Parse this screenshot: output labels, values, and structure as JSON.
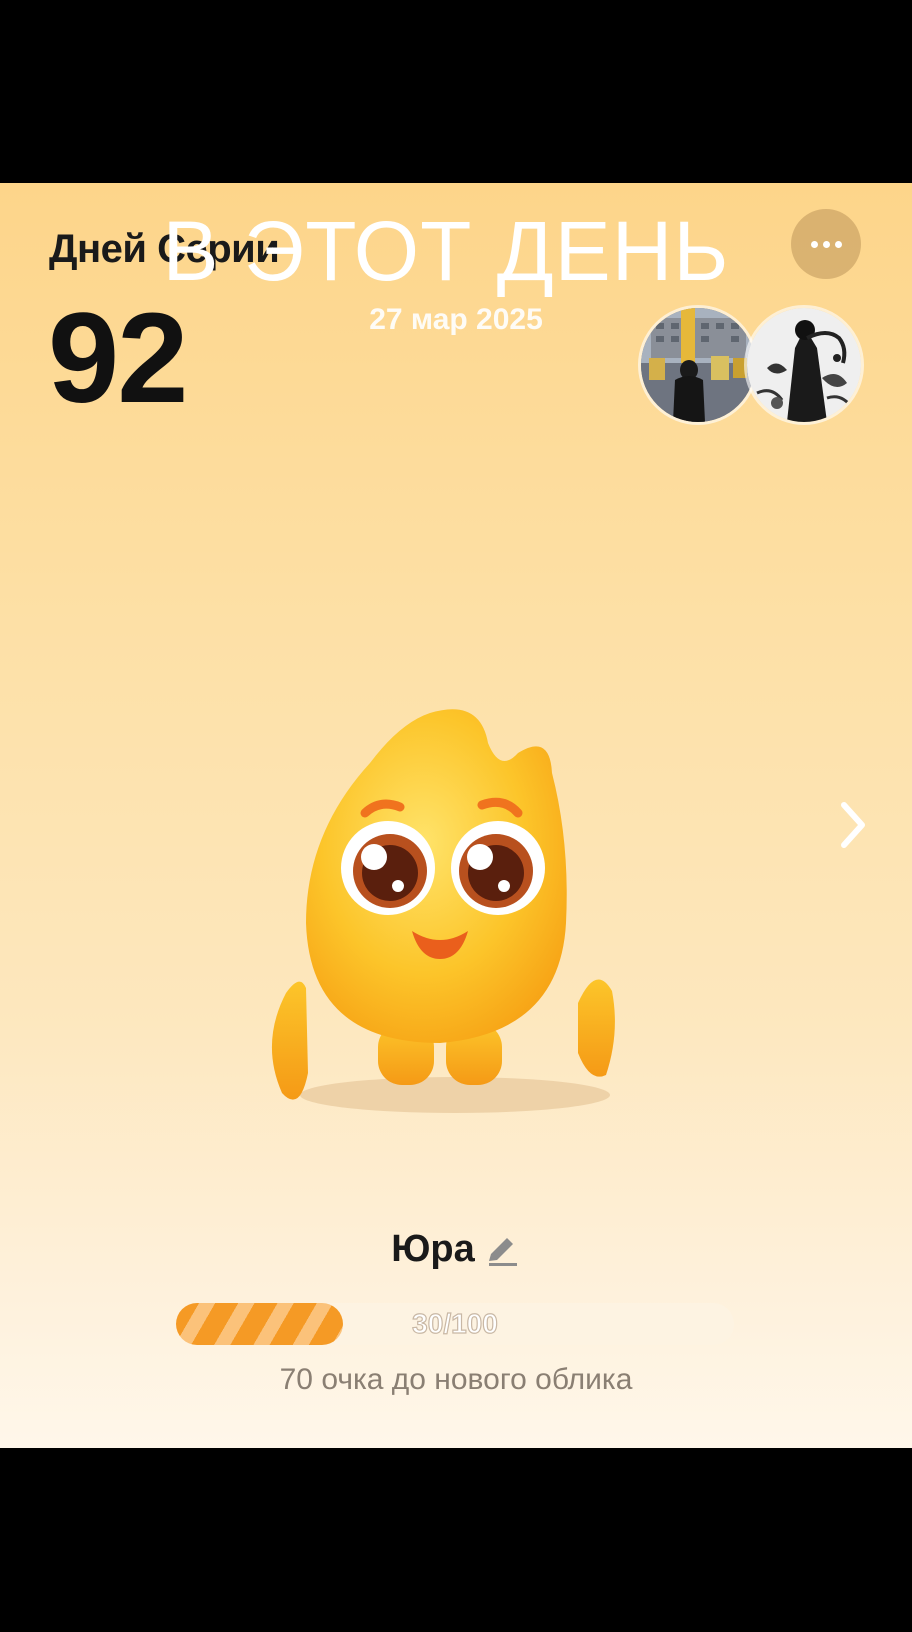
{
  "streak": {
    "label": "Дней Серии",
    "value": "92"
  },
  "overlay": {
    "title": "В ЭТОТ ДЕНЬ",
    "date": "27 мар 2025"
  },
  "header": {
    "more_icon": "more-horizontal-icon"
  },
  "avatars": [
    {
      "name": "friend-avatar-1"
    },
    {
      "name": "friend-avatar-2"
    }
  ],
  "pet": {
    "name": "Юра",
    "edit_icon": "pencil-icon"
  },
  "progress": {
    "text": "30/100",
    "current": 30,
    "max": 100,
    "hint": "70 очка до нового облика"
  },
  "colors": {
    "accent": "#f59a25",
    "background_top": "#fdd58a",
    "background_bottom": "#fff7ea"
  }
}
